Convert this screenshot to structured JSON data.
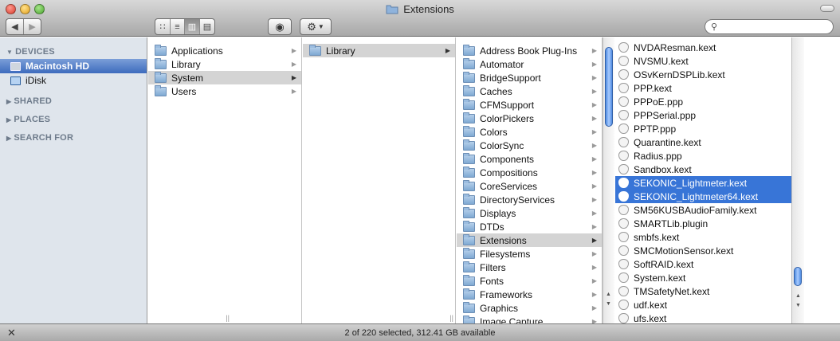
{
  "window": {
    "title": "Extensions"
  },
  "toolbar": {
    "back_icon": "chevron-left-icon",
    "forward_icon": "chevron-right-icon",
    "view_modes": [
      {
        "name": "icon-view",
        "glyph": "∷"
      },
      {
        "name": "list-view",
        "glyph": "≡"
      },
      {
        "name": "column-view",
        "glyph": "▥"
      },
      {
        "name": "coverflow-view",
        "glyph": "▤"
      }
    ],
    "quicklook_icon": "eye-icon",
    "action_icon": "gear-icon",
    "search": {
      "value": "",
      "placeholder": ""
    }
  },
  "sidebar": {
    "devices_label": "DEVICES",
    "devices": [
      {
        "label": "Macintosh HD",
        "selected": true
      },
      {
        "label": "iDisk",
        "selected": false
      }
    ],
    "shared_label": "SHARED",
    "places_label": "PLACES",
    "search_for_label": "SEARCH FOR"
  },
  "columns": {
    "col1": [
      "Applications",
      "Library",
      "System",
      "Users"
    ],
    "col2": [
      "Library"
    ],
    "col3": [
      "Address Book Plug-Ins",
      "Automator",
      "BridgeSupport",
      "Caches",
      "CFMSupport",
      "ColorPickers",
      "Colors",
      "ColorSync",
      "Components",
      "Compositions",
      "CoreServices",
      "DirectoryServices",
      "Displays",
      "DTDs",
      "Extensions",
      "Filesystems",
      "Filters",
      "Fonts",
      "Frameworks",
      "Graphics",
      "Image Capture"
    ],
    "col4": [
      "NVDAResman.kext",
      "NVSMU.kext",
      "OSvKernDSPLib.kext",
      "PPP.kext",
      "PPPoE.ppp",
      "PPPSerial.ppp",
      "PPTP.ppp",
      "Quarantine.kext",
      "Radius.ppp",
      "Sandbox.kext",
      "SEKONIC_Lightmeter.kext",
      "SEKONIC_Lightmeter64.kext",
      "SM56KUSBAudioFamily.kext",
      "SMARTLib.plugin",
      "smbfs.kext",
      "SMCMotionSensor.kext",
      "SoftRAID.kext",
      "System.kext",
      "TMSafetyNet.kext",
      "udf.kext",
      "ufs.kext"
    ]
  },
  "status": {
    "text": "2 of 220 selected, 312.41 GB available"
  },
  "colors": {
    "selection": "#3875d7",
    "sidebar_bg": "#dfe5ec",
    "sidebar_header": "#6e7b8b"
  }
}
